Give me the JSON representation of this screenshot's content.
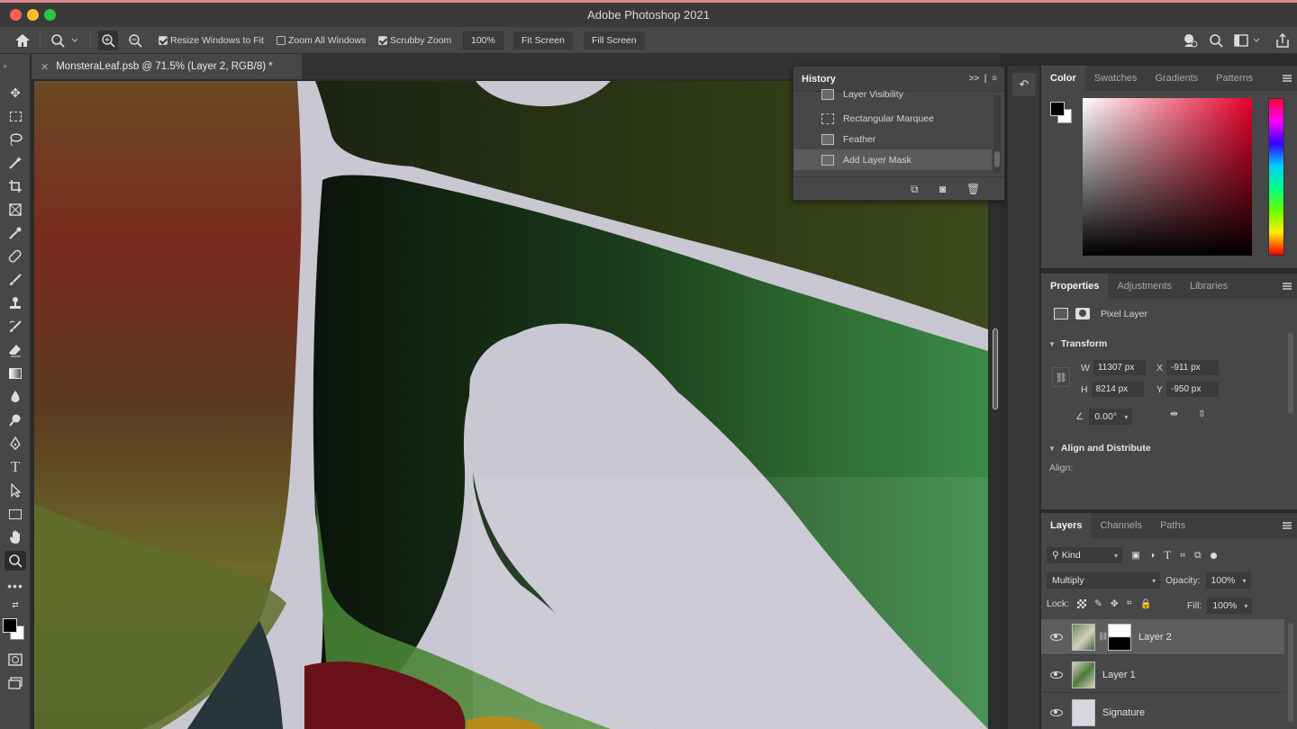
{
  "app": {
    "title": "Adobe Photoshop 2021"
  },
  "options_bar": {
    "resize_windows": "Resize Windows to Fit",
    "zoom_all": "Zoom All Windows",
    "scrubby_zoom": "Scrubby Zoom",
    "zoom_value": "100%",
    "fit_screen": "Fit Screen",
    "fill_screen": "Fill Screen"
  },
  "document": {
    "tab_title": "MonsteraLeaf.psb @ 71.5% (Layer 2, RGB/8) *"
  },
  "history": {
    "title": "History",
    "items": [
      {
        "label": "Layer Visibility",
        "icon": "doc-icon"
      },
      {
        "label": "Rectangular Marquee",
        "icon": "marquee-icon"
      },
      {
        "label": "Feather",
        "icon": "doc-icon"
      },
      {
        "label": "Add Layer Mask",
        "icon": "doc-icon",
        "selected": true
      }
    ]
  },
  "color_panel": {
    "tabs": [
      "Color",
      "Swatches",
      "Gradients",
      "Patterns"
    ]
  },
  "properties": {
    "tabs": [
      "Properties",
      "Adjustments",
      "Libraries"
    ],
    "layer_type": "Pixel Layer",
    "transform_title": "Transform",
    "w_label": "W",
    "w": "11307 px",
    "h_label": "H",
    "h": "8214 px",
    "x_label": "X",
    "x": "-911 px",
    "y_label": "Y",
    "y": "-950 px",
    "angle": "0.00°",
    "align_title": "Align and Distribute",
    "align_label": "Align:"
  },
  "layers": {
    "tabs": [
      "Layers",
      "Channels",
      "Paths"
    ],
    "filter": "Kind",
    "blend_mode": "Multiply",
    "opacity_label": "Opacity:",
    "opacity": "100%",
    "lock_label": "Lock:",
    "fill_label": "Fill:",
    "fill": "100%",
    "items": [
      {
        "name": "Layer 2",
        "selected": true
      },
      {
        "name": "Layer 1",
        "selected": false
      },
      {
        "name": "Signature",
        "selected": false
      }
    ]
  },
  "colors": {
    "accent_selected": "#5e5e5e",
    "panel_bg": "#474747",
    "app_bg": "#2b2b2b"
  }
}
